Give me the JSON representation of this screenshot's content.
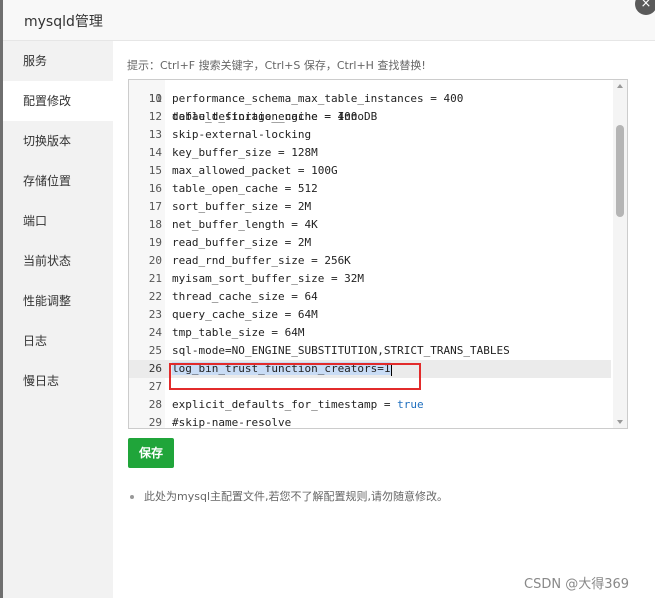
{
  "dialog": {
    "title": "mysqld管理",
    "close_label": "×"
  },
  "sidebar": {
    "items": [
      {
        "label": "服务"
      },
      {
        "label": "配置修改"
      },
      {
        "label": "切换版本"
      },
      {
        "label": "存储位置"
      },
      {
        "label": "端口"
      },
      {
        "label": "当前状态"
      },
      {
        "label": "性能调整"
      },
      {
        "label": "日志"
      },
      {
        "label": "慢日志"
      }
    ],
    "active_index": 1
  },
  "main": {
    "hint": "提示：Ctrl+F 搜索关键字，Ctrl+S 保存，Ctrl+H 查找替换!",
    "editor": {
      "partial_top_text": "default_storage_engine = InnoDB",
      "lines": [
        {
          "num": "11",
          "text": "performance_schema_max_table_instances = 400"
        },
        {
          "num": "12",
          "text": "table_definition_cache = 400"
        },
        {
          "num": "13",
          "text": "skip-external-locking"
        },
        {
          "num": "14",
          "text": "key_buffer_size = 128M"
        },
        {
          "num": "15",
          "text": "max_allowed_packet = 100G"
        },
        {
          "num": "16",
          "text": "table_open_cache = 512"
        },
        {
          "num": "17",
          "text": "sort_buffer_size = 2M"
        },
        {
          "num": "18",
          "text": "net_buffer_length = 4K"
        },
        {
          "num": "19",
          "text": "read_buffer_size = 2M"
        },
        {
          "num": "20",
          "text": "read_rnd_buffer_size = 256K"
        },
        {
          "num": "21",
          "text": "myisam_sort_buffer_size = 32M"
        },
        {
          "num": "22",
          "text": "thread_cache_size = 64"
        },
        {
          "num": "23",
          "text": "query_cache_size = 64M"
        },
        {
          "num": "24",
          "text": "tmp_table_size = 64M"
        },
        {
          "num": "25",
          "text": "sql-mode=NO_ENGINE_SUBSTITUTION,STRICT_TRANS_TABLES"
        },
        {
          "num": "26",
          "text": "log_bin_trust_function_creators=1"
        },
        {
          "num": "27",
          "text": ""
        },
        {
          "num": "28",
          "text_before": "explicit_defaults_for_timestamp = ",
          "keyword": "true"
        },
        {
          "num": "29",
          "text": "#skip-name-resolve"
        }
      ]
    },
    "save_label": "保存",
    "note": "此处为mysql主配置文件,若您不了解配置规则,请勿随意修改。"
  },
  "watermark": "CSDN @大得369",
  "colors": {
    "accent_green": "#20a53a",
    "highlight_red": "#e22b2b",
    "selection_blue": "#c9dcf5",
    "keyword_blue": "#1f6fbf"
  }
}
